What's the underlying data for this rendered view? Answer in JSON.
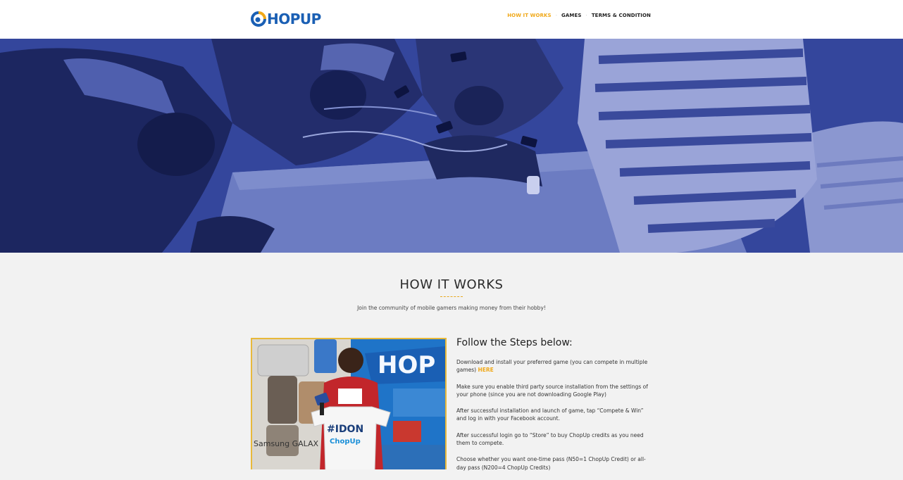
{
  "header": {
    "logo_text": "HOPUP",
    "nav": [
      {
        "label": "HOW IT WORKS",
        "active": true
      },
      {
        "label": "GAMES",
        "active": false
      },
      {
        "label": "TERMS & CONDITION",
        "active": false
      }
    ],
    "separator": "·"
  },
  "section": {
    "title": "HOW IT WORKS",
    "subtitle": "Join the community of mobile gamers making money from their hobby!"
  },
  "steps": {
    "title": "Follow the Steps below:",
    "items": [
      {
        "text": "Download and install your preferred game (you can compete in multiple games) ",
        "link": "HERE"
      },
      {
        "text": "Make sure you enable third party source installation from the settings of your phone (since you are not downloading Google Play)"
      },
      {
        "text": "After successful installation and launch of game, tap “Compete & Win” and log in with your Facebook account."
      },
      {
        "text": "After successful login go to “Store” to buy ChopUp credits as you need them to compete."
      },
      {
        "text": "Choose whether you want one-time pass (N50=1 ChopUp Credit) or all-day pass (N200=4 ChopUp Credits)"
      }
    ]
  },
  "photo": {
    "banner_text": "HOP",
    "shirt_text_1": "#IDON",
    "shirt_text_2": "ChopUp",
    "brand_text": "Samsung GALAX"
  },
  "colors": {
    "accent": "#f0a818",
    "brand_blue": "#1a5fb4",
    "hero_overlay": "#2d3fa0"
  }
}
